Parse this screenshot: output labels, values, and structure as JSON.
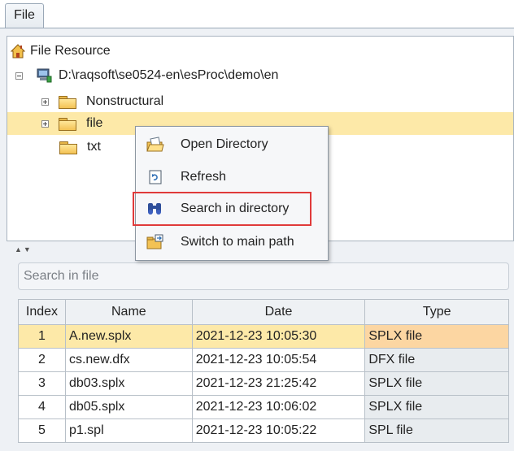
{
  "tabs": [
    {
      "label": "File"
    }
  ],
  "tree": {
    "root_label": "File Resource",
    "path_label": "D:\\raqsoft\\se0524-en\\esProc\\demo\\en",
    "folders": [
      {
        "label": "Nonstructural"
      },
      {
        "label": "file"
      },
      {
        "label": "txt"
      }
    ]
  },
  "context_menu": {
    "items": [
      {
        "label": "Open Directory",
        "icon": "open-folder-icon"
      },
      {
        "label": "Refresh",
        "icon": "refresh-icon"
      },
      {
        "label": "Search in directory",
        "icon": "binoculars-icon",
        "highlighted": true
      },
      {
        "label": "Switch to main path",
        "icon": "switch-path-icon"
      }
    ]
  },
  "search": {
    "placeholder": "Search in file"
  },
  "table": {
    "headers": [
      "Index",
      "Name",
      "Date",
      "Type"
    ],
    "rows": [
      {
        "index": "1",
        "name": "A.new.splx",
        "date": "2021-12-23 10:05:30",
        "type": "SPLX file",
        "selected": true
      },
      {
        "index": "2",
        "name": "cs.new.dfx",
        "date": "2021-12-23 10:05:54",
        "type": "DFX file"
      },
      {
        "index": "3",
        "name": "db03.splx",
        "date": "2021-12-23 21:25:42",
        "type": "SPLX file"
      },
      {
        "index": "4",
        "name": "db05.splx",
        "date": "2021-12-23 10:06:02",
        "type": "SPLX file"
      },
      {
        "index": "5",
        "name": "p1.spl",
        "date": "2021-12-23 10:05:22",
        "type": "SPL file"
      }
    ]
  },
  "colors": {
    "selection": "#fde9a8",
    "highlight_border": "#e03a3a"
  }
}
